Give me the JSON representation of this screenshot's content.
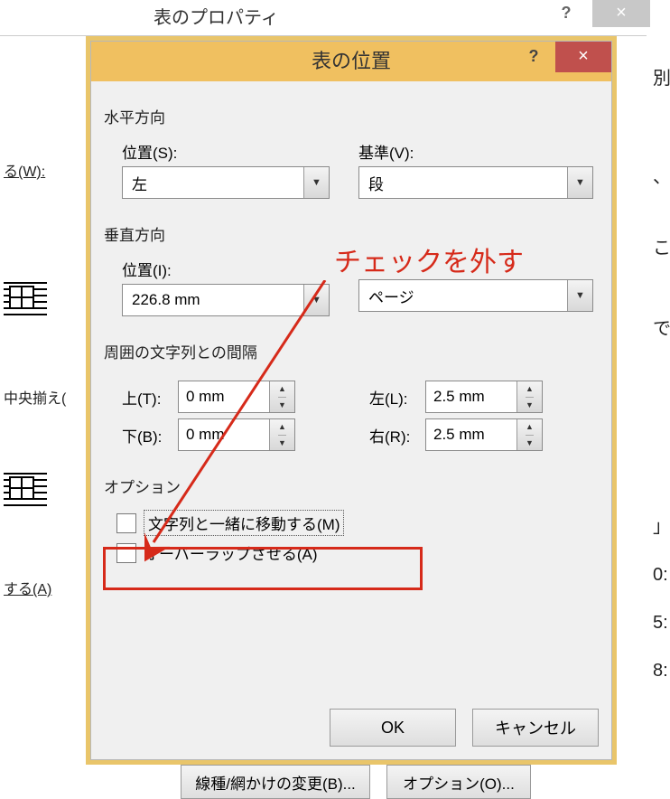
{
  "parent_dialog": {
    "title": "表のプロパティ",
    "help": "?",
    "close": "×",
    "left_items": [
      "る(W):",
      "中央揃え(",
      "する(A)"
    ],
    "bottom_buttons": {
      "border": "線種/網かけの変更(B)...",
      "options": "オプション(O)..."
    }
  },
  "dialog": {
    "title": "表の位置",
    "help": "?",
    "close": "×",
    "horizontal": {
      "heading": "水平方向",
      "position_label": "位置(S):",
      "position_value": "左",
      "basis_label": "基準(V):",
      "basis_value": "段"
    },
    "vertical": {
      "heading": "垂直方向",
      "position_label": "位置(I):",
      "position_value": "226.8 mm",
      "basis_value": "ページ"
    },
    "spacing": {
      "heading": "周囲の文字列との間隔",
      "top_label": "上(T):",
      "top_value": "0 mm",
      "bottom_label": "下(B):",
      "bottom_value": "0 mm",
      "left_label": "左(L):",
      "left_value": "2.5 mm",
      "right_label": "右(R):",
      "right_value": "2.5 mm"
    },
    "options": {
      "heading": "オプション",
      "move_with_text": "文字列と一緒に移動する(M)",
      "allow_overlap": "オーバーラップさせる(A)"
    },
    "buttons": {
      "ok": "OK",
      "cancel": "キャンセル"
    }
  },
  "annotation": {
    "text": "チェックを外す"
  },
  "right_strip": [
    "別",
    " ",
    "、",
    "こ",
    "で",
    "｣",
    "0:",
    "5:",
    "8:"
  ]
}
